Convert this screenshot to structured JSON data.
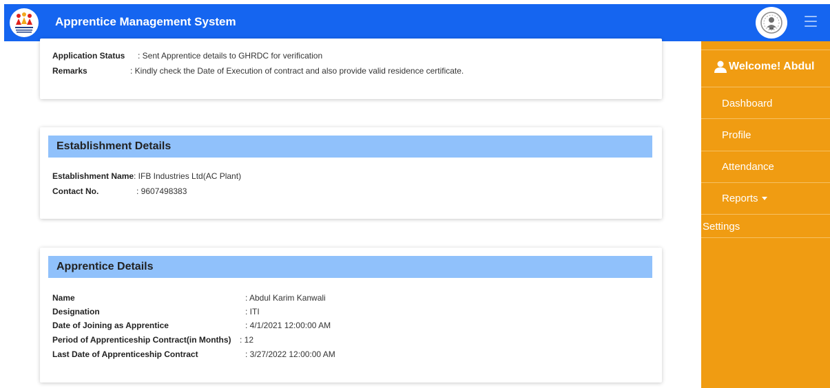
{
  "header": {
    "title": "Apprentice Management System",
    "logo_left_icon": "hrdc-logo-icon",
    "logo_right_icon": "government-emblem-icon",
    "menu_icon": "hamburger-menu-icon",
    "bg_color": "#1565f0"
  },
  "sidebar": {
    "welcome": "Welcome! Abdul",
    "items": [
      "Dashboard",
      "Profile",
      "Attendance",
      "Reports",
      "Settings"
    ],
    "bg_color": "#f09c12"
  },
  "status_card": {
    "status_label": "Application Status",
    "status_value": ": Sent Apprentice details to GHRDC for verification",
    "remarks_label": "Remarks",
    "remarks_value": ": Kindly check the Date of Execution of contract and also provide valid residence certificate."
  },
  "establishment": {
    "heading": "Establishment Details",
    "name_label": "Establishment Name",
    "name_value": ": IFB Industries Ltd(AC Plant)",
    "contact_label": "Contact No.",
    "contact_value": ": 9607498383"
  },
  "apprentice": {
    "heading": "Apprentice Details",
    "rows": [
      {
        "label": "Name",
        "value": ": Abdul Karim Kanwali"
      },
      {
        "label": "Designation",
        "value": ": ITI"
      },
      {
        "label": "Date of Joining as Apprentice",
        "value": ": 4/1/2021 12:00:00 AM"
      },
      {
        "label": "Period of Apprenticeship Contract(in Months)",
        "value": ": 12"
      },
      {
        "label": "Last Date of Apprenticeship Contract",
        "value": ": 3/27/2022 12:00:00 AM"
      }
    ]
  }
}
